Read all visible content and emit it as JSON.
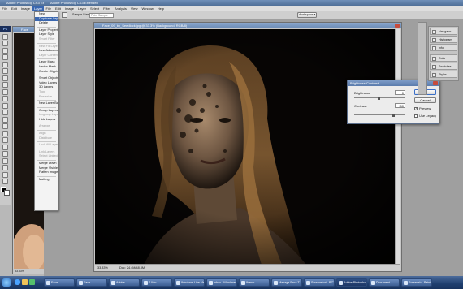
{
  "left_app": {
    "title": "Adobe Photoshop CS3 Extended",
    "menu": [
      "File",
      "Edit",
      "Image",
      "Layer",
      "Select",
      "Filter",
      "Analysis",
      "View"
    ],
    "active_menu": "Layer",
    "options": {
      "sample_size_label": "Sample Size:",
      "sample_size_value": "Point Sample"
    }
  },
  "layer_menu": {
    "items": [
      {
        "label": "New",
        "disabled": false
      },
      {
        "label": "Duplicate Layer...",
        "disabled": false,
        "highlight": true
      },
      {
        "label": "Delete",
        "disabled": false
      },
      {
        "sep": true
      },
      {
        "label": "Layer Properties...",
        "disabled": false
      },
      {
        "label": "Layer Style",
        "disabled": false
      },
      {
        "label": "Smart Filter",
        "disabled": true
      },
      {
        "sep": true
      },
      {
        "label": "New Fill Layer",
        "disabled": true
      },
      {
        "label": "New Adjustment Layer",
        "disabled": false
      },
      {
        "label": "Layer Content Options...",
        "disabled": true
      },
      {
        "sep": true
      },
      {
        "label": "Layer Mask",
        "disabled": false
      },
      {
        "label": "Vector Mask",
        "disabled": false
      },
      {
        "label": "Create Clipping Mask",
        "disabled": false
      },
      {
        "sep": true
      },
      {
        "label": "Smart Objects",
        "disabled": false
      },
      {
        "label": "Video Layers",
        "disabled": false
      },
      {
        "label": "3D Layers",
        "disabled": false
      },
      {
        "label": "Type",
        "disabled": true
      },
      {
        "label": "Rasterize",
        "disabled": true
      },
      {
        "sep": true
      },
      {
        "label": "New Layer Based Slice",
        "disabled": false
      },
      {
        "sep": true
      },
      {
        "label": "Group Layers",
        "disabled": false
      },
      {
        "label": "Ungroup Layers",
        "disabled": true
      },
      {
        "label": "Hide Layers",
        "disabled": false
      },
      {
        "sep": true
      },
      {
        "label": "Arrange",
        "disabled": true
      },
      {
        "sep": true
      },
      {
        "label": "Align",
        "disabled": true
      },
      {
        "label": "Distribute",
        "disabled": true
      },
      {
        "sep": true
      },
      {
        "label": "Lock All Layers in Group...",
        "disabled": true
      },
      {
        "sep": true
      },
      {
        "label": "Link Layers",
        "disabled": true
      },
      {
        "label": "Select Linked Layers",
        "disabled": true
      },
      {
        "sep": true
      },
      {
        "label": "Merge Down",
        "disabled": false
      },
      {
        "label": "Merge Visible",
        "disabled": false
      },
      {
        "label": "Flatten Image",
        "disabled": false
      },
      {
        "sep": true
      },
      {
        "label": "Matting",
        "disabled": false
      }
    ]
  },
  "left_doc": {
    "tab_label": "Face",
    "zoom": "33.33%"
  },
  "main_app": {
    "title": "Adobe Photoshop CS3 Extended",
    "menu": [
      "File",
      "Edit",
      "Image",
      "Layer",
      "Select",
      "Filter",
      "Analysis",
      "View",
      "Window",
      "Help"
    ],
    "options": {
      "sample_size_label": "Sample Size:",
      "sample_size_value": "Point Sample",
      "workspace_label": "Workspace ▾"
    }
  },
  "document": {
    "title": "Face_09_by_Seedlock.jpg @ 33.3% (Background, RGB/8)",
    "zoom": "33.33%",
    "doc_info": "Doc: 24.4M/48.8M"
  },
  "dialog": {
    "title": "Brightness/Contrast",
    "brightness_label": "Brightness:",
    "brightness_value": "0",
    "contrast_label": "Contrast:",
    "contrast_value": "+50",
    "ok_label": "OK",
    "cancel_label": "Cancel",
    "preview_label": "Preview",
    "preview_checked": true,
    "legacy_label": "Use Legacy",
    "legacy_checked": false
  },
  "panels": [
    {
      "label": "Navigator",
      "icon": "navigator-icon"
    },
    {
      "label": "Histogram",
      "icon": "histogram-icon"
    },
    {
      "label": "Info",
      "icon": "info-icon"
    },
    {
      "label": "Color",
      "icon": "color-icon"
    },
    {
      "label": "Swatches",
      "icon": "swatches-icon"
    },
    {
      "label": "Styles",
      "icon": "styles-icon"
    }
  ],
  "taskbar": {
    "items": [
      {
        "label": "Face...",
        "active": false
      },
      {
        "label": "Face...",
        "active": false
      },
      {
        "label": "Adobe...",
        "active": false
      },
      {
        "label": "7 Win...",
        "active": false
      },
      {
        "label": "Windows Live Me...",
        "active": false
      },
      {
        "label": "Inbox - Windows ...",
        "active": false
      },
      {
        "label": "Wasm",
        "active": false
      },
      {
        "label": "Manage Back T...",
        "active": false
      },
      {
        "label": "Screenshot - RCTS",
        "active": false
      },
      {
        "label": "Adobe Photosho...",
        "active": true
      },
      {
        "label": "Document...",
        "active": false
      },
      {
        "label": "Screensh - Paint",
        "active": false
      }
    ]
  },
  "colors": {
    "accent": "#3a67b0",
    "taskbar": "#1f3f6f",
    "canvas": "#060504"
  }
}
